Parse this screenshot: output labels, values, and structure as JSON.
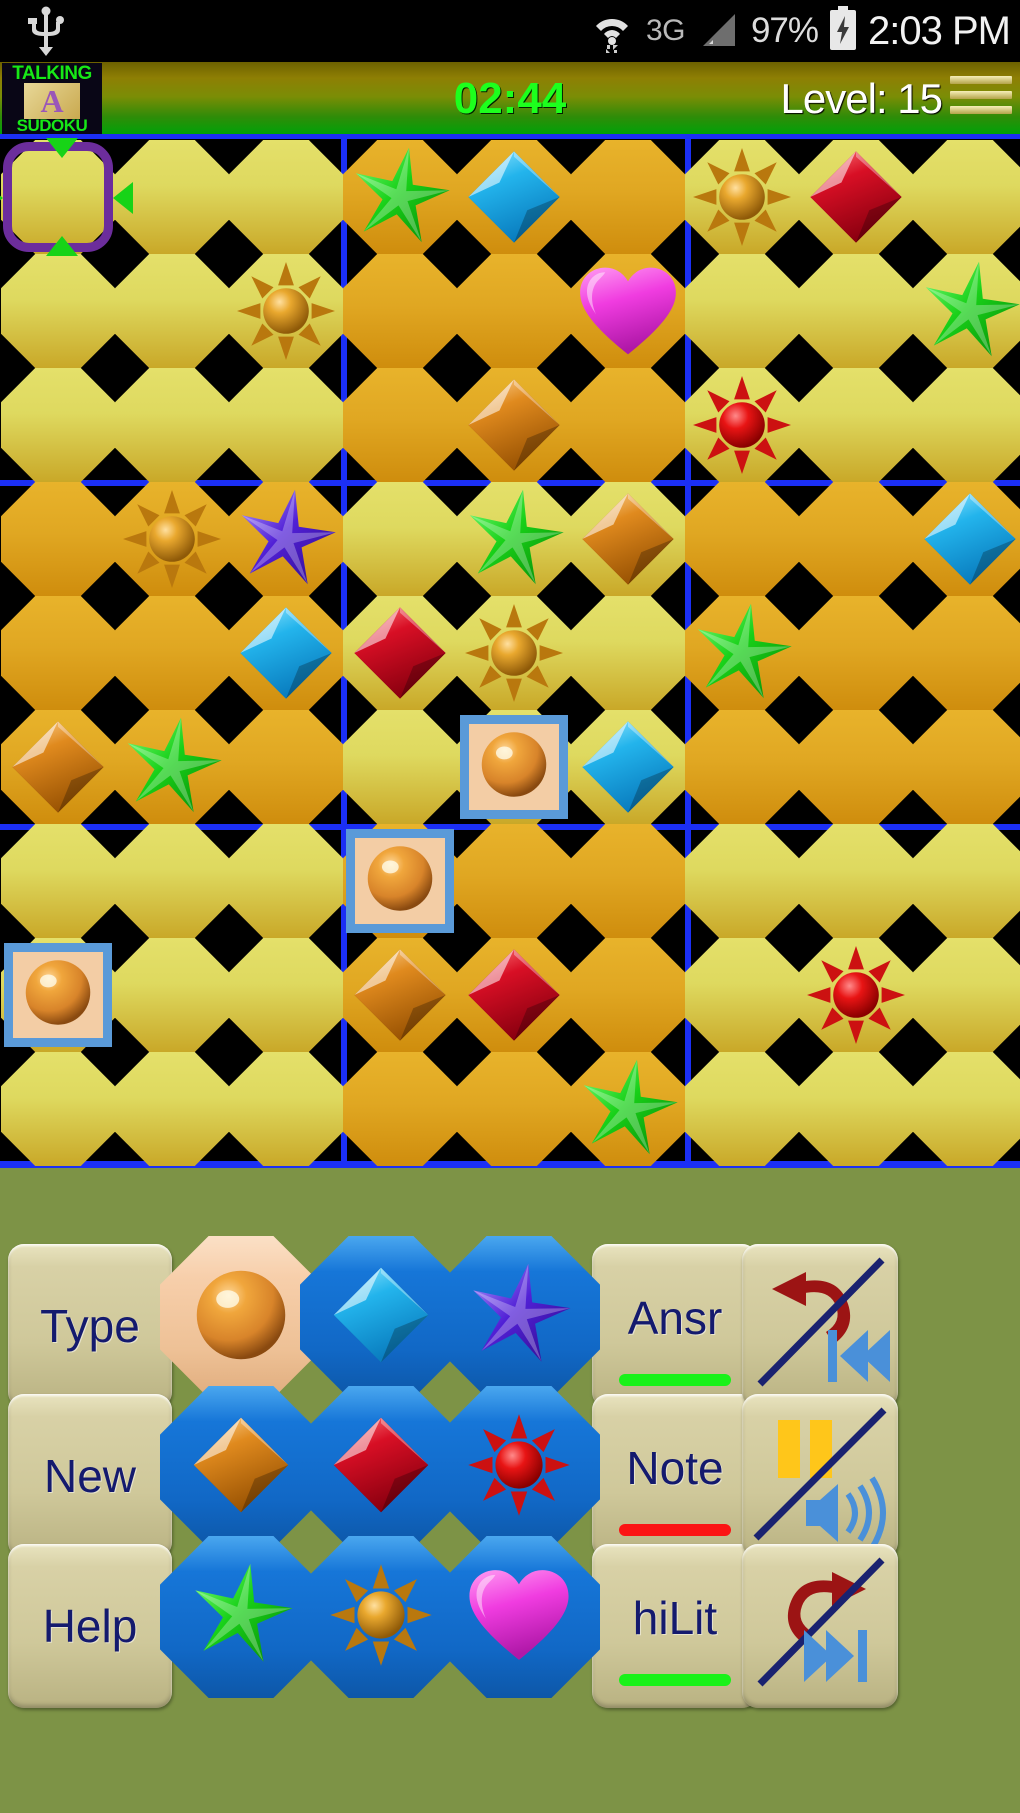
{
  "status_bar": {
    "usb_icon": "usb-icon",
    "wifi_icon": "wifi-icon",
    "network_label": "3G",
    "signal_icon": "signal-bars-icon",
    "battery_percent": "97%",
    "battery_icon": "battery-charging-icon",
    "clock": "2:03 PM"
  },
  "title_bar": {
    "app_icon": {
      "top_text": "TALKING",
      "letter": "A",
      "bottom_text": "SUDOKU"
    },
    "timer": "02:44",
    "level": "Level: 15",
    "menu_icon": "hamburger-menu-icon"
  },
  "board": {
    "size": 9,
    "block_shades": [
      [
        "light",
        "dark",
        "light"
      ],
      [
        "dark",
        "light",
        "dark"
      ],
      [
        "light",
        "dark",
        "light"
      ]
    ],
    "cursor": {
      "row": 1,
      "col": 1
    },
    "cells": [
      {
        "row": 1,
        "col": 1,
        "symbol": "",
        "state": "cursor"
      },
      {
        "row": 1,
        "col": 4,
        "symbol": "green-star",
        "state": "given"
      },
      {
        "row": 1,
        "col": 5,
        "symbol": "blue-diamond",
        "state": "given"
      },
      {
        "row": 1,
        "col": 7,
        "symbol": "gold-sun",
        "state": "given"
      },
      {
        "row": 1,
        "col": 8,
        "symbol": "red-diamond",
        "state": "given"
      },
      {
        "row": 2,
        "col": 3,
        "symbol": "gold-sun",
        "state": "given"
      },
      {
        "row": 2,
        "col": 6,
        "symbol": "pink-heart",
        "state": "given"
      },
      {
        "row": 2,
        "col": 9,
        "symbol": "green-star",
        "state": "given"
      },
      {
        "row": 3,
        "col": 5,
        "symbol": "orange-diamond",
        "state": "given"
      },
      {
        "row": 3,
        "col": 7,
        "symbol": "red-sun",
        "state": "given"
      },
      {
        "row": 4,
        "col": 2,
        "symbol": "gold-sun",
        "state": "given"
      },
      {
        "row": 4,
        "col": 3,
        "symbol": "purple-star",
        "state": "given"
      },
      {
        "row": 4,
        "col": 5,
        "symbol": "green-star",
        "state": "given"
      },
      {
        "row": 4,
        "col": 6,
        "symbol": "orange-diamond",
        "state": "given"
      },
      {
        "row": 4,
        "col": 9,
        "symbol": "blue-diamond",
        "state": "given"
      },
      {
        "row": 5,
        "col": 3,
        "symbol": "blue-diamond",
        "state": "given"
      },
      {
        "row": 5,
        "col": 4,
        "symbol": "red-diamond",
        "state": "given"
      },
      {
        "row": 5,
        "col": 5,
        "symbol": "gold-sun",
        "state": "given"
      },
      {
        "row": 5,
        "col": 7,
        "symbol": "green-star",
        "state": "given"
      },
      {
        "row": 6,
        "col": 1,
        "symbol": "orange-diamond",
        "state": "given"
      },
      {
        "row": 6,
        "col": 2,
        "symbol": "green-star",
        "state": "given"
      },
      {
        "row": 6,
        "col": 5,
        "symbol": "orange-ball",
        "state": "user"
      },
      {
        "row": 6,
        "col": 6,
        "symbol": "blue-diamond",
        "state": "given"
      },
      {
        "row": 7,
        "col": 4,
        "symbol": "orange-ball",
        "state": "user"
      },
      {
        "row": 8,
        "col": 1,
        "symbol": "orange-ball",
        "state": "user"
      },
      {
        "row": 8,
        "col": 4,
        "symbol": "orange-diamond",
        "state": "given"
      },
      {
        "row": 8,
        "col": 5,
        "symbol": "red-diamond",
        "state": "given"
      },
      {
        "row": 8,
        "col": 8,
        "symbol": "red-sun",
        "state": "given"
      },
      {
        "row": 9,
        "col": 6,
        "symbol": "green-star",
        "state": "given"
      }
    ]
  },
  "panel": {
    "background_color": "#7d9346",
    "text_buttons": [
      {
        "id": "type",
        "label": "Type",
        "bar": null
      },
      {
        "id": "new",
        "label": "New",
        "bar": null
      },
      {
        "id": "help",
        "label": "Help",
        "bar": null
      },
      {
        "id": "ansr",
        "label": "Ansr",
        "bar": "green"
      },
      {
        "id": "note",
        "label": "Note",
        "bar": "red"
      },
      {
        "id": "hilit",
        "label": "hiLit",
        "bar": "green"
      }
    ],
    "symbol_buttons": [
      {
        "id": "sym-ball",
        "symbol": "orange-ball",
        "chip": "peach"
      },
      {
        "id": "sym-bluedia",
        "symbol": "blue-diamond",
        "chip": "blue"
      },
      {
        "id": "sym-purstar",
        "symbol": "purple-star",
        "chip": "blue"
      },
      {
        "id": "sym-orgdia",
        "symbol": "orange-diamond",
        "chip": "blue"
      },
      {
        "id": "sym-reddia",
        "symbol": "red-diamond",
        "chip": "blue"
      },
      {
        "id": "sym-redsun",
        "symbol": "red-sun",
        "chip": "blue"
      },
      {
        "id": "sym-grnstar",
        "symbol": "green-star",
        "chip": "blue"
      },
      {
        "id": "sym-goldsun",
        "symbol": "gold-sun",
        "chip": "blue"
      },
      {
        "id": "sym-heart",
        "symbol": "pink-heart",
        "chip": "blue"
      }
    ],
    "icon_buttons": [
      {
        "id": "undo",
        "icon": "undo-rewind-disabled-icon"
      },
      {
        "id": "pause",
        "icon": "pause-mute-disabled-icon"
      },
      {
        "id": "redo",
        "icon": "redo-forward-disabled-icon"
      }
    ]
  },
  "colors": {
    "grid_line": "#1b2ff5",
    "cell_light": "#ded95f",
    "cell_dark": "#e0a722",
    "cursor_purple": "#6c2d9c",
    "cursor_green": "#17d317",
    "user_border": "#5a9ad8",
    "user_fill": "#f3cda5",
    "timer_green": "#1dff1d",
    "button_text": "#141a6e"
  }
}
